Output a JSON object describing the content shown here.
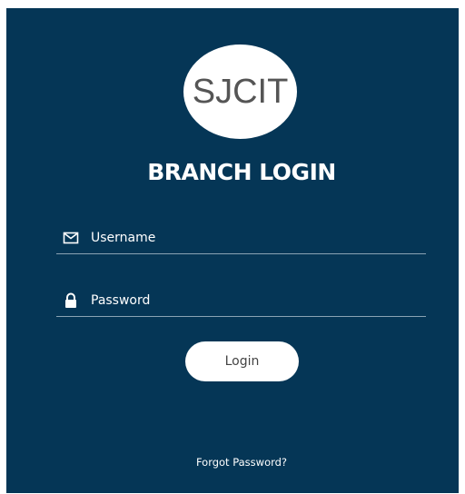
{
  "logo": {
    "text": "SJCIT"
  },
  "title": "BRANCH LOGIN",
  "form": {
    "username": {
      "placeholder": "Username",
      "value": "",
      "icon": "envelope-icon"
    },
    "password": {
      "placeholder": "Password",
      "value": "",
      "icon": "lock-icon"
    },
    "login_label": "Login"
  },
  "forgot_password": "Forgot Password?",
  "colors": {
    "panel": "#053656",
    "text": "#ffffff",
    "button_bg": "#ffffff",
    "logo_text": "#555555"
  }
}
